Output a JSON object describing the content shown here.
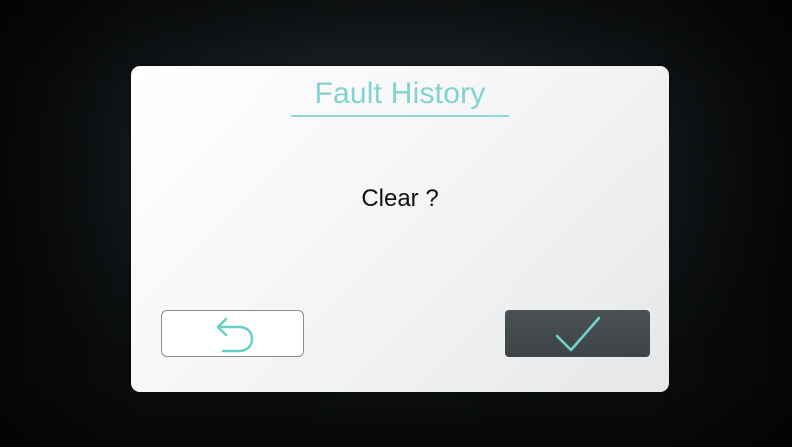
{
  "dialog": {
    "title": "Fault History",
    "message": "Clear ?"
  },
  "buttons": {
    "back_icon": "back-arrow-icon",
    "confirm_icon": "checkmark-icon"
  },
  "colors": {
    "title": "#7fd3d0",
    "accent": "#66cfc8",
    "confirm_bg": "#464d4f",
    "screen_bg": "#0d1012"
  }
}
